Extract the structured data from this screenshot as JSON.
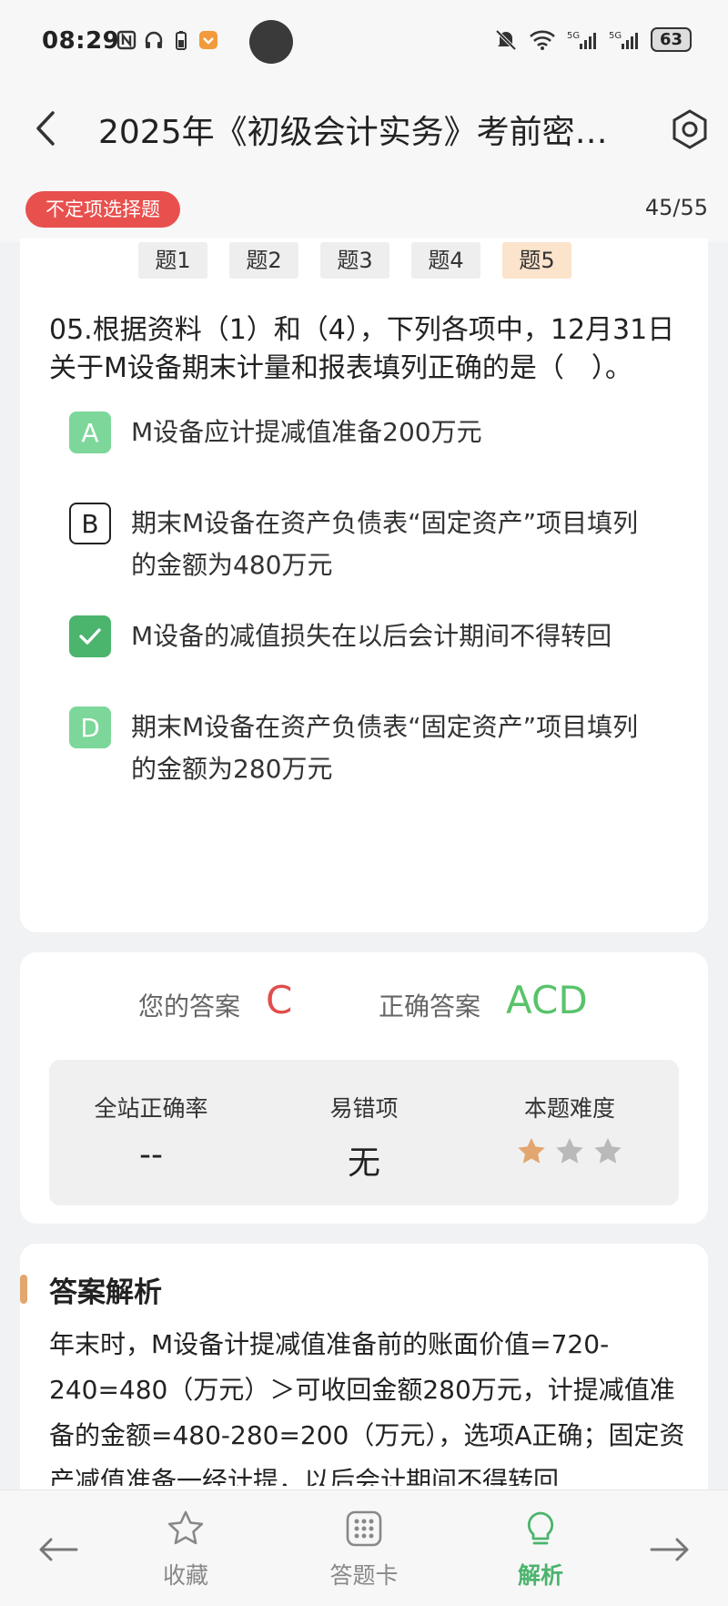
{
  "status_bar": {
    "time": "08:29",
    "battery": "63"
  },
  "header": {
    "title": "2025年《初级会计实务》考前密…"
  },
  "subheader": {
    "question_type": "不定项选择题",
    "progress": "45/55"
  },
  "sub_tabs": [
    {
      "label": "题1",
      "active": false
    },
    {
      "label": "题2",
      "active": false
    },
    {
      "label": "题3",
      "active": false
    },
    {
      "label": "题4",
      "active": false
    },
    {
      "label": "题5",
      "active": true
    }
  ],
  "question": {
    "text": "05.根据资料（1）和（4），下列各项中，12月31日关于M设备期末计量和报表填列正确的是（　）。"
  },
  "options": [
    {
      "letter": "A",
      "text": "M设备应计提减值准备200万元",
      "state": "correct-unselected"
    },
    {
      "letter": "B",
      "text": "期末M设备在资产负债表“固定资产”项目填列的金额为480万元",
      "state": "incorrect"
    },
    {
      "letter": "C",
      "text": "M设备的减值损失在以后会计期间不得转回",
      "state": "selected-correct"
    },
    {
      "letter": "D",
      "text": "期末M设备在资产负债表“固定资产”项目填列的金额为280万元",
      "state": "correct-unselected"
    }
  ],
  "answer": {
    "your_label": "您的答案",
    "your_value": "C",
    "correct_label": "正确答案",
    "correct_value": "ACD",
    "your_color": "#e14d4b",
    "correct_color": "#58c36a"
  },
  "stats": {
    "accuracy_label": "全站正确率",
    "accuracy_value": "--",
    "error_label": "易错项",
    "error_value": "无",
    "difficulty_label": "本题难度",
    "difficulty_rating": 1,
    "difficulty_max": 3
  },
  "explanation": {
    "title": "答案解析",
    "text": "年末时，M设备计提减值准备前的账面价值=720-240=480（万元）＞可收回金额280万元，计提减值准备的金额=480-280=200（万元），选项A正确；固定资产减值准备一经计提，以后会计期间不得转回"
  },
  "bottom_nav": {
    "favorite": "收藏",
    "answer_card": "答题卡",
    "analysis": "解析",
    "active_color": "#4bb46d"
  }
}
